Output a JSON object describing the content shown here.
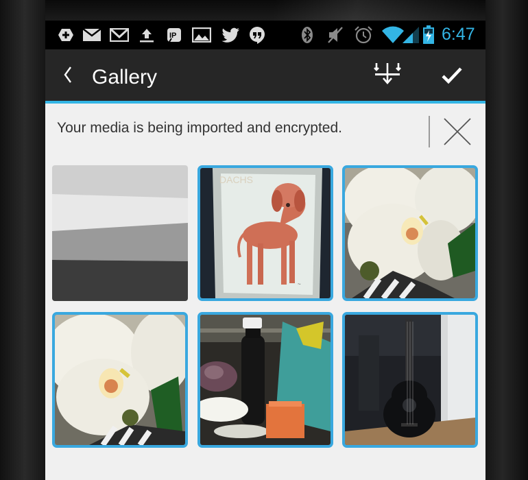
{
  "status_bar": {
    "time": "6:47",
    "left_icons": [
      "add-icon",
      "mail-icon",
      "gmail-icon",
      "upload-icon",
      "parking-icon",
      "image-icon",
      "twitter-icon",
      "hangouts-icon"
    ],
    "right_icons": [
      "bluetooth-icon",
      "muted-icon",
      "alarm-icon",
      "wifi-icon",
      "signal-icon",
      "battery-charging-icon"
    ],
    "accent": "#33b5e5"
  },
  "action_bar": {
    "title": "Gallery",
    "icons": [
      "back-chevron-icon",
      "import-icon",
      "checkmark-icon"
    ]
  },
  "notice": {
    "message": "Your media is being imported and encrypted.",
    "close_icon": "close-icon"
  },
  "gallery": {
    "selection_color": "#39a8df",
    "items": [
      {
        "subject": "placeholder",
        "selected": false
      },
      {
        "subject": "dog-print",
        "selected": true
      },
      {
        "subject": "orchid",
        "selected": true
      },
      {
        "subject": "orchid",
        "selected": true
      },
      {
        "subject": "bottle-shelf",
        "selected": true
      },
      {
        "subject": "guitar",
        "selected": true
      }
    ]
  }
}
